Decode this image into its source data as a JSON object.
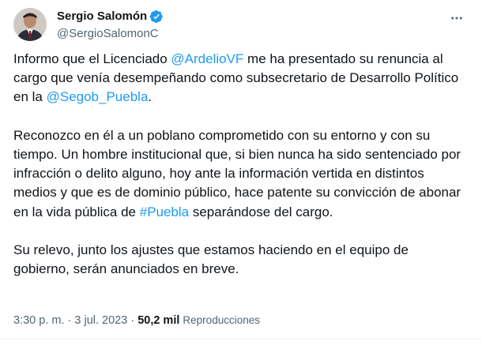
{
  "author": {
    "display_name": "Sergio Salomón",
    "handle": "@SergioSalomonC",
    "verified": true,
    "verified_color": "#1d9bf0"
  },
  "menu": {
    "icon": "more-horizontal-icon"
  },
  "tweet": {
    "p1": {
      "t1": "Informo que el Licenciado ",
      "mention1": "@ArdelioVF",
      "t2": " me ha presentado su renuncia al cargo que venía desempeñando como subsecretario de Desarrollo Político en la ",
      "mention2": "@Segob_Puebla",
      "t3": "."
    },
    "p2": {
      "t1": "Reconozco en él a un poblano comprometido con su entorno y con su tiempo. Un hombre institucional que, si bien nunca ha sido sentenciado por infracción o delito alguno, hoy ante la información vertida en distintos medios y que es de dominio público, hace patente su convicción de abonar en la vida pública de ",
      "hashtag": "#Puebla",
      "t2": " separándose del cargo."
    },
    "p3": {
      "t1": "Su relevo, junto los ajustes que estamos haciendo en el equipo de gobierno, serán anunciados en breve."
    }
  },
  "meta": {
    "time": "3:30 p. m.",
    "separator": " · ",
    "date": "3 jul. 2023",
    "views_count": "50,2 mil",
    "views_label": "Reproducciones"
  },
  "colors": {
    "text": "#0f1419",
    "secondary": "#536471",
    "link": "#1d9bf0"
  }
}
